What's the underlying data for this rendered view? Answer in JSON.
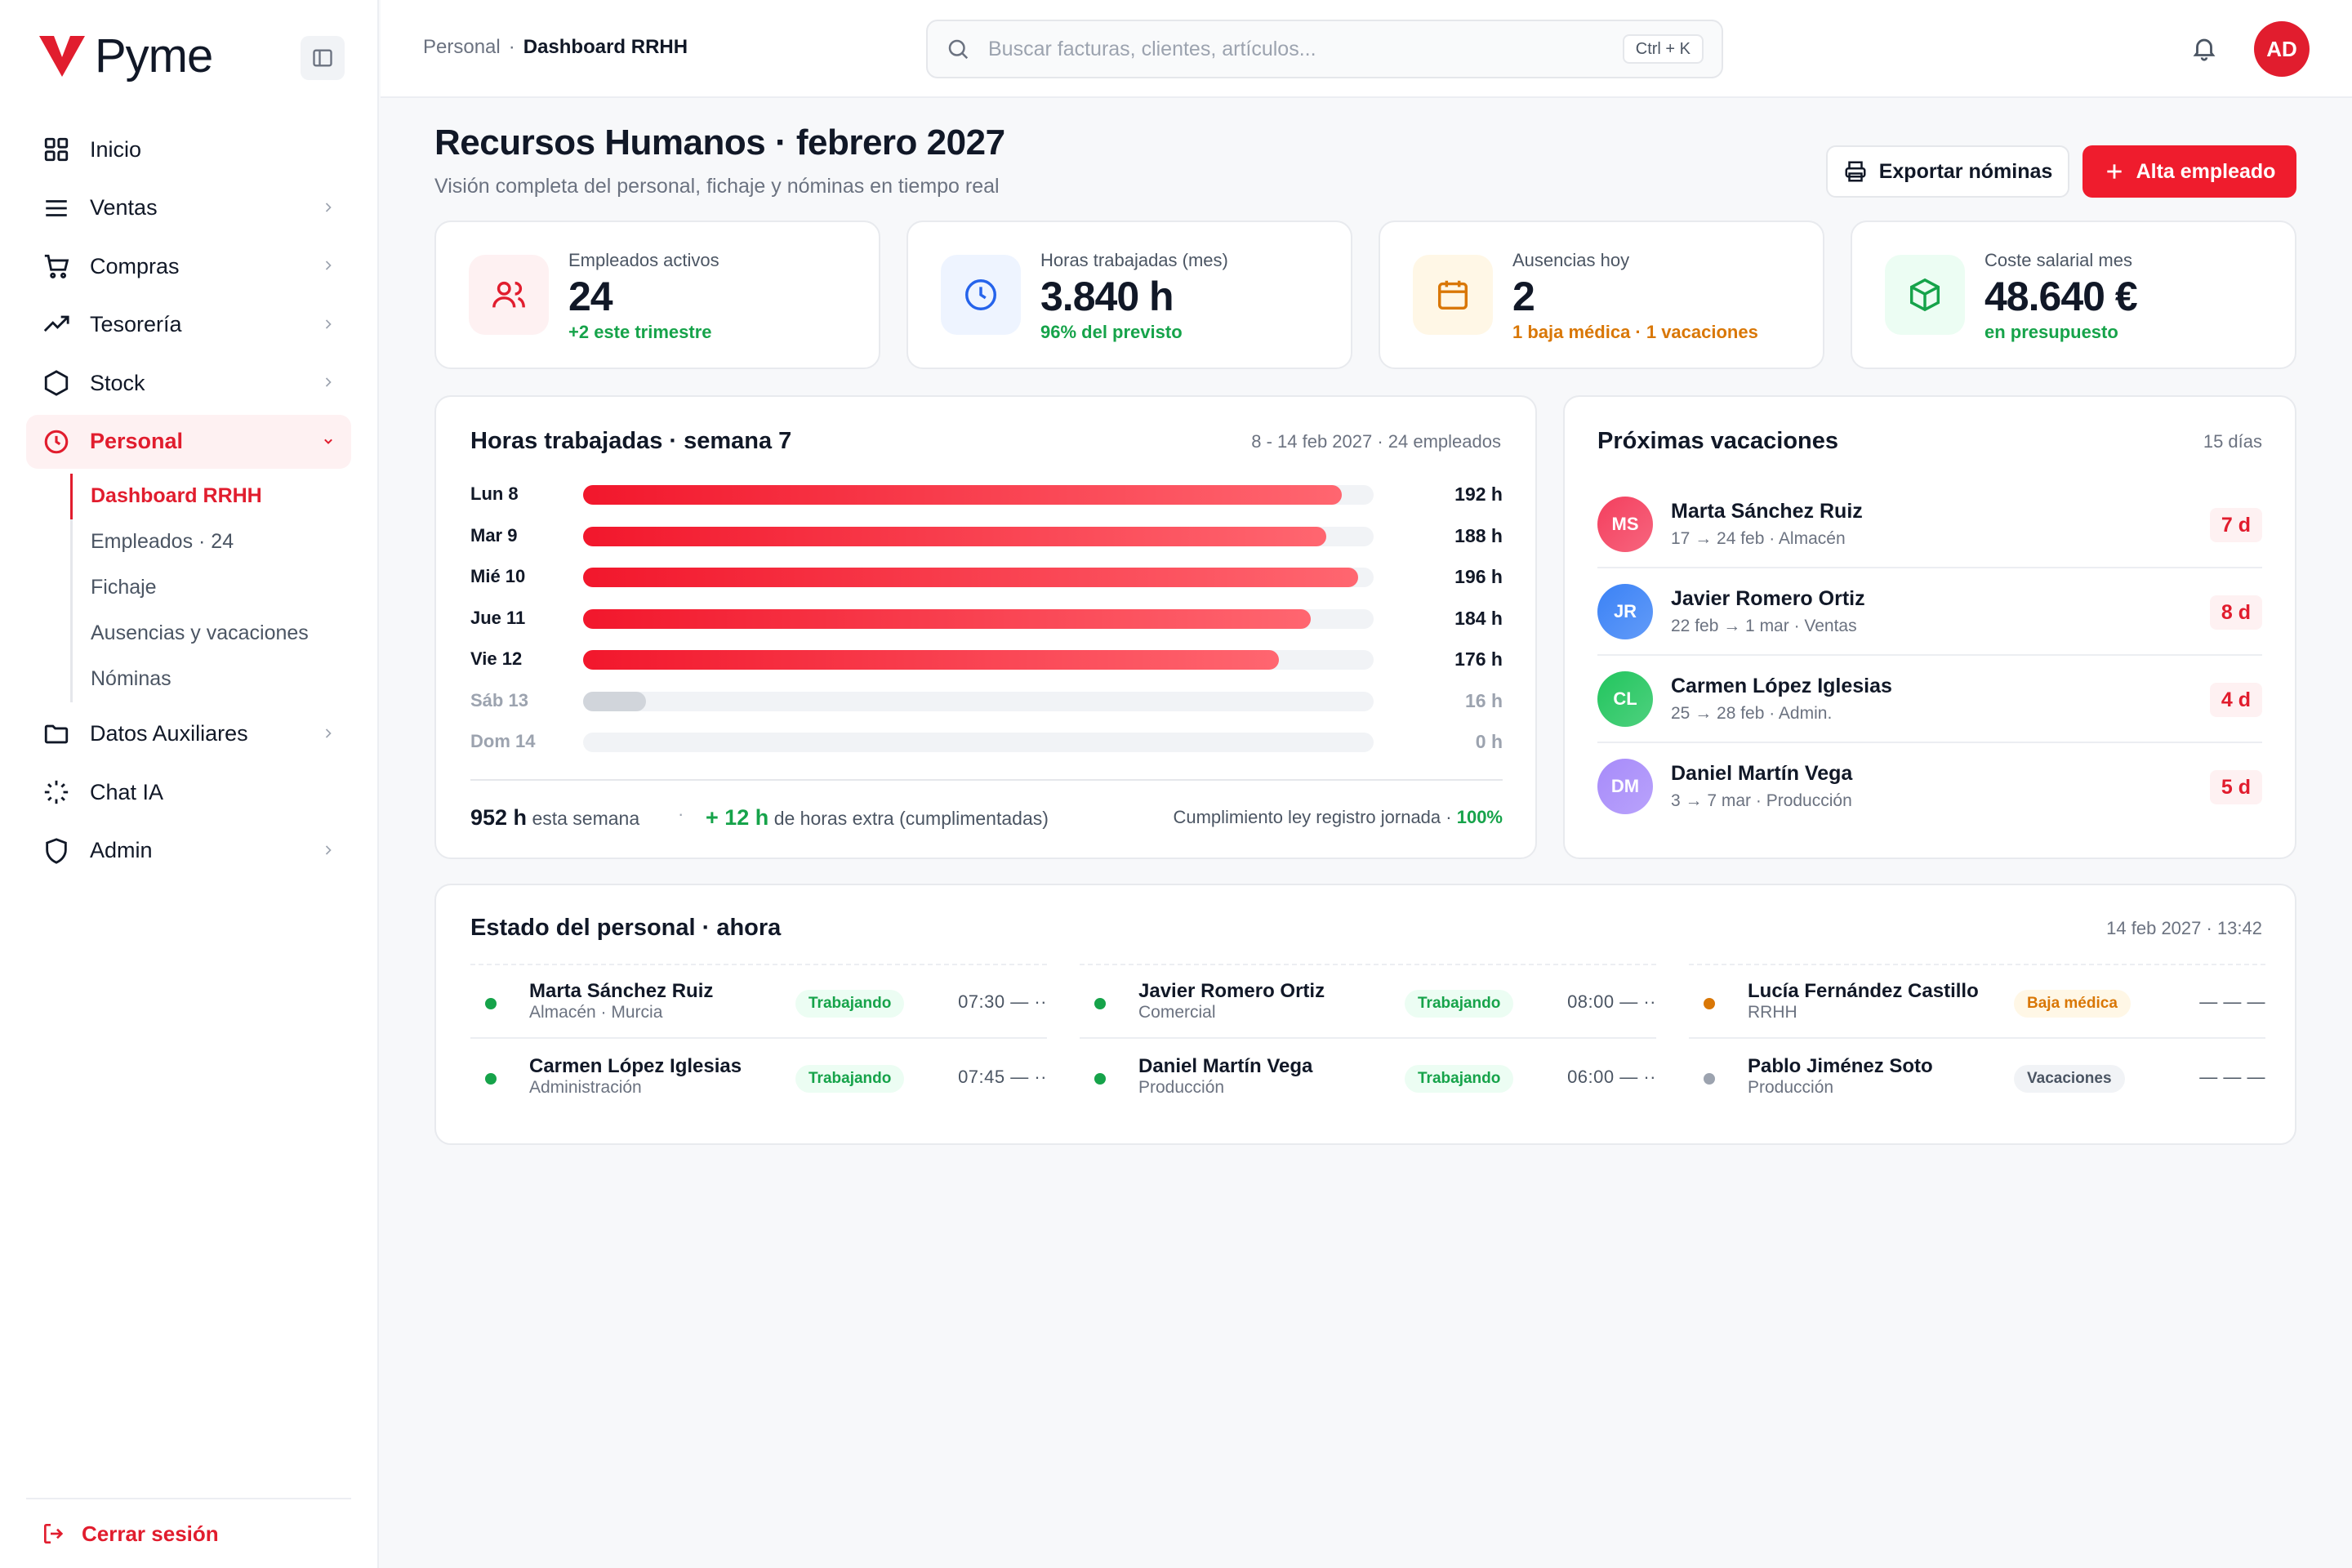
{
  "brand": {
    "name": "Pyme",
    "accent": "#e11d2e"
  },
  "sidebar": {
    "items": [
      {
        "label": "Inicio",
        "icon": "grid-icon",
        "chev": false
      },
      {
        "label": "Ventas",
        "icon": "list-icon",
        "chev": true
      },
      {
        "label": "Compras",
        "icon": "cart-icon",
        "chev": true
      },
      {
        "label": "Tesorería",
        "icon": "trend-icon",
        "chev": true
      },
      {
        "label": "Stock",
        "icon": "hexagon-icon",
        "chev": true
      },
      {
        "label": "Personal",
        "icon": "clock-icon",
        "chev": true,
        "active": true,
        "chev_label": "v"
      },
      {
        "label": "Datos Auxiliares",
        "icon": "folder-icon",
        "chev": true
      },
      {
        "label": "Chat IA",
        "icon": "loader-icon",
        "chev": false
      },
      {
        "label": "Admin",
        "icon": "shield-icon",
        "chev": true
      }
    ],
    "sub_items": [
      "Dashboard RRHH",
      "Empleados · 24",
      "Fichaje",
      "Ausencias y vacaciones",
      "Nóminas"
    ],
    "logout": "Cerrar sesión"
  },
  "topbar": {
    "breadcrumb": {
      "parent": "Personal",
      "sep": "·",
      "current": "Dashboard RRHH"
    },
    "search": {
      "placeholder": "Buscar facturas, clientes, artículos...",
      "shortcut": "Ctrl + K"
    },
    "avatar": "AD"
  },
  "header": {
    "title": "Recursos Humanos · febrero 2027",
    "subtitle": "Visión completa del personal, fichaje y nóminas en tiempo real",
    "export_label": "Exportar nóminas",
    "add_label": "Alta empleado"
  },
  "kpis": [
    {
      "label": "Empleados activos",
      "value": "24",
      "foot": "+2 este trimestre",
      "foot_color": "#16a34a",
      "icon": "users-icon",
      "bg": "#fef1f2",
      "fg": "#e11d2e"
    },
    {
      "label": "Horas trabajadas (mes)",
      "value": "3.840 h",
      "foot": "96% del previsto",
      "foot_color": "#16a34a",
      "icon": "clock-icon",
      "bg": "#eef4ff",
      "fg": "#2563eb"
    },
    {
      "label": "Ausencias hoy",
      "value": "2",
      "foot": "1 baja médica · 1 vacaciones",
      "foot_color": "#d97706",
      "icon": "calendar-icon",
      "bg": "#fff7e6",
      "fg": "#d97706"
    },
    {
      "label": "Coste salarial mes",
      "value": "48.640 €",
      "foot": "en presupuesto",
      "foot_color": "#16a34a",
      "icon": "box-icon",
      "bg": "#ecfdf3",
      "fg": "#16a34a"
    }
  ],
  "hours": {
    "title": "Horas trabajadas · semana 7",
    "meta": "8 - 14 feb 2027 · 24 empleados",
    "max": 200,
    "rows": [
      {
        "day": "Lun 8",
        "value": 192,
        "label": "192 h"
      },
      {
        "day": "Mar 9",
        "value": 188,
        "label": "188 h"
      },
      {
        "day": "Mié 10",
        "value": 196,
        "label": "196 h"
      },
      {
        "day": "Jue 11",
        "value": 184,
        "label": "184 h"
      },
      {
        "day": "Vie 12",
        "value": 176,
        "label": "176 h"
      },
      {
        "day": "Sáb 13",
        "value": 16,
        "label": "16 h",
        "muted": true
      },
      {
        "day": "Dom 14",
        "value": 0,
        "label": "0 h",
        "muted": true
      }
    ],
    "total_value": "952 h",
    "total_text": "esta semana",
    "dot": "·",
    "extra_value": "+ 12 h",
    "extra_text": "de horas extra (cumplimentadas)",
    "law_text": "Cumplimiento ley registro jornada ·",
    "law_value": "100%"
  },
  "vacations": {
    "title": "Próximas vacaciones",
    "meta": "15 días",
    "items": [
      {
        "initials": "MS",
        "name": "Marta Sánchez Ruiz",
        "detail": "17 → 24 feb · Almacén",
        "days": "7 d",
        "color": "#f43f5e"
      },
      {
        "initials": "JR",
        "name": "Javier Romero Ortiz",
        "detail": "22 feb → 1 mar · Ventas",
        "days": "8 d",
        "color": "#3b82f6"
      },
      {
        "initials": "CL",
        "name": "Carmen López Iglesias",
        "detail": "25 → 28 feb · Admin.",
        "days": "4 d",
        "color": "#22c55e"
      },
      {
        "initials": "DM",
        "name": "Daniel Martín Vega",
        "detail": "3 → 7 mar · Producción",
        "days": "5 d",
        "color": "#a78bfa"
      }
    ]
  },
  "staff": {
    "title": "Estado del personal · ahora",
    "meta": "14 feb 2027 · 13:42",
    "people": [
      {
        "name": "Marta Sánchez Ruiz",
        "dept": "Almacén · Murcia",
        "status": "Trabajando",
        "kind": "work",
        "time": "07:30 — ··",
        "dot": "#16a34a"
      },
      {
        "name": "Javier Romero Ortiz",
        "dept": "Comercial",
        "status": "Trabajando",
        "kind": "work",
        "time": "08:00 — ··",
        "dot": "#16a34a"
      },
      {
        "name": "Lucía Fernández Castillo",
        "dept": "RRHH",
        "status": "Baja médica",
        "kind": "sick",
        "time": "— — —",
        "dot": "#d97706"
      },
      {
        "name": "Carmen López Iglesias",
        "dept": "Administración",
        "status": "Trabajando",
        "kind": "work",
        "time": "07:45 — ··",
        "dot": "#16a34a"
      },
      {
        "name": "Daniel Martín Vega",
        "dept": "Producción",
        "status": "Trabajando",
        "kind": "work",
        "time": "06:00 — ··",
        "dot": "#16a34a"
      },
      {
        "name": "Pablo Jiménez Soto",
        "dept": "Producción",
        "status": "Vacaciones",
        "kind": "vac",
        "time": "— — —",
        "dot": "#9ca3af"
      }
    ]
  }
}
